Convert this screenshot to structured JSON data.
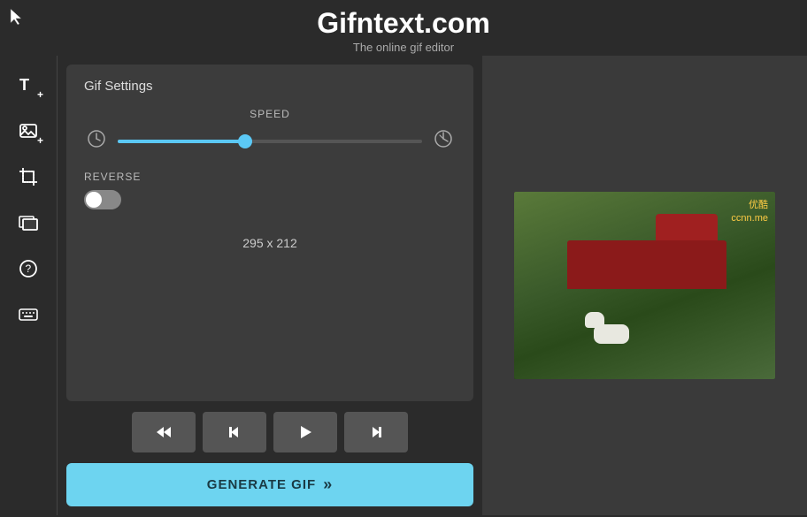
{
  "header": {
    "title": "Gifntext.com",
    "subtitle": "The online gif editor"
  },
  "sidebar": {
    "items": [
      {
        "name": "add-text",
        "icon": "T+",
        "label": "Add Text"
      },
      {
        "name": "add-image",
        "icon": "img+",
        "label": "Add Image"
      },
      {
        "name": "crop",
        "icon": "crop",
        "label": "Crop"
      },
      {
        "name": "frame",
        "icon": "frame",
        "label": "Frame"
      },
      {
        "name": "help",
        "icon": "?",
        "label": "Help"
      },
      {
        "name": "keyboard",
        "icon": "kb",
        "label": "Keyboard"
      }
    ]
  },
  "gif_settings": {
    "title": "Gif Settings",
    "speed": {
      "label": "SPEED",
      "value": 42,
      "min": 0,
      "max": 100
    },
    "reverse": {
      "label": "REVERSE",
      "enabled": false
    },
    "dimensions": "295 x 212"
  },
  "playback": {
    "buttons": [
      {
        "name": "rewind",
        "icon": "⏪"
      },
      {
        "name": "prev-frame",
        "icon": "⏮"
      },
      {
        "name": "play",
        "icon": "▶"
      },
      {
        "name": "next-frame",
        "icon": "⏭"
      }
    ]
  },
  "generate": {
    "label": "GENERATE GIF",
    "chevrons": "»"
  },
  "preview": {
    "watermark_line1": "优酷",
    "watermark_line2": "ccnn.me"
  }
}
